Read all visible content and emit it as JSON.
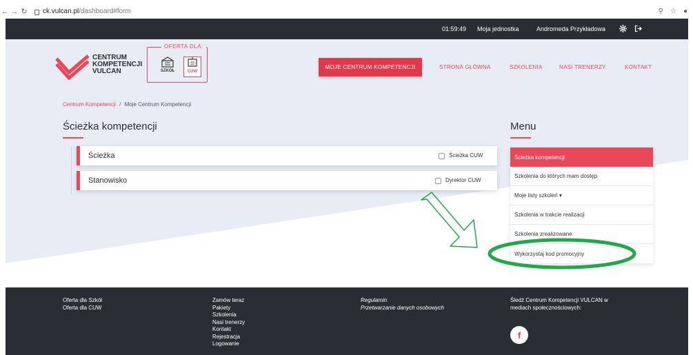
{
  "browser": {
    "host": "ck.vulcan.pl",
    "path": "/dashboard#form"
  },
  "topbar": {
    "time": "01:59:49",
    "unit_link": "Moja jednostka",
    "user_name": "Andromeda Przykładowa"
  },
  "logo": {
    "line1": "CENTRUM",
    "line2": "KOMPETENCJI",
    "line3": "VULCAN"
  },
  "offer": {
    "label": "OFERTA DLA:",
    "items": [
      {
        "label": "SZKÓŁ"
      },
      {
        "label": "CUW"
      }
    ]
  },
  "nav": {
    "primary_button": "MOJE CENTRUM KOMPETENCJI",
    "links": [
      "STRONA GŁÓWNA",
      "SZKOLENIA",
      "NASI TRENERZY",
      "KONTAKT"
    ]
  },
  "breadcrumb": {
    "parent": "Centrum Kompetencji",
    "separator": "/",
    "current": "Moje Centrum Kompetencji"
  },
  "page": {
    "title": "Ścieżka kompetencji"
  },
  "form_rows": [
    {
      "label": "Ścieżka",
      "checkbox_label": "Ścieżka CUW"
    },
    {
      "label": "Stanowisko",
      "checkbox_label": "Dyrektor CUW"
    }
  ],
  "menu": {
    "title": "Menu",
    "items": [
      "Ścieżka kompetencji",
      "Szkolenia do których mam dostęp",
      "Moje listy szkoleń ▾",
      "Szkolenia w trakcie realizacji",
      "Szkolenia zrealizowane",
      "Wykorzystaj kod promocyjny"
    ]
  },
  "footer": {
    "col1": [
      "Oferta dla Szkół",
      "Oferta dla CUW"
    ],
    "col2": [
      "Zamów teraz",
      "Pakiety",
      "Szkolenia",
      "Nasi trenerzy",
      "Kontakt",
      "Rejestracja",
      "Logowanie"
    ],
    "col3": [
      "Regulamin",
      "Przetwarzanie danych osobowych"
    ],
    "social_line1": "Śledź Centrum Kompetencji VULCAN w",
    "social_line2": "mediach społecznościowych:",
    "facebook_glyph": "f"
  },
  "colors": {
    "accent": "#e84858",
    "dark": "#2a2d33",
    "annotation_green": "#22a84a"
  }
}
